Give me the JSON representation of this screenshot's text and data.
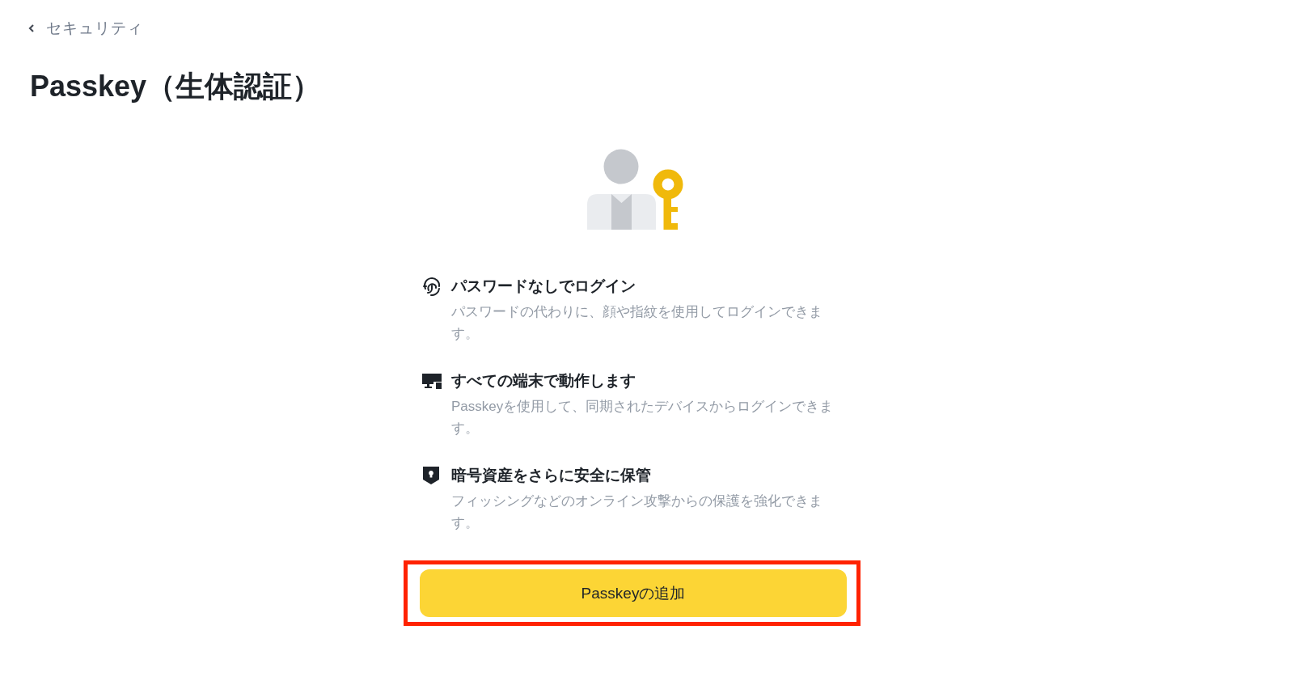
{
  "back_link": {
    "label": "セキュリティ"
  },
  "title": "Passkey（生体認証）",
  "features": [
    {
      "title": "パスワードなしでログイン",
      "description": "パスワードの代わりに、顔や指紋を使用してログインできます。"
    },
    {
      "title": "すべての端末で動作します",
      "description": "Passkeyを使用して、同期されたデバイスからログインできます。"
    },
    {
      "title": "暗号資産をさらに安全に保管",
      "description": "フィッシングなどのオンライン攻撃からの保護を強化できます。"
    }
  ],
  "add_button": {
    "label": "Passkeyの追加",
    "highlighted": true
  }
}
